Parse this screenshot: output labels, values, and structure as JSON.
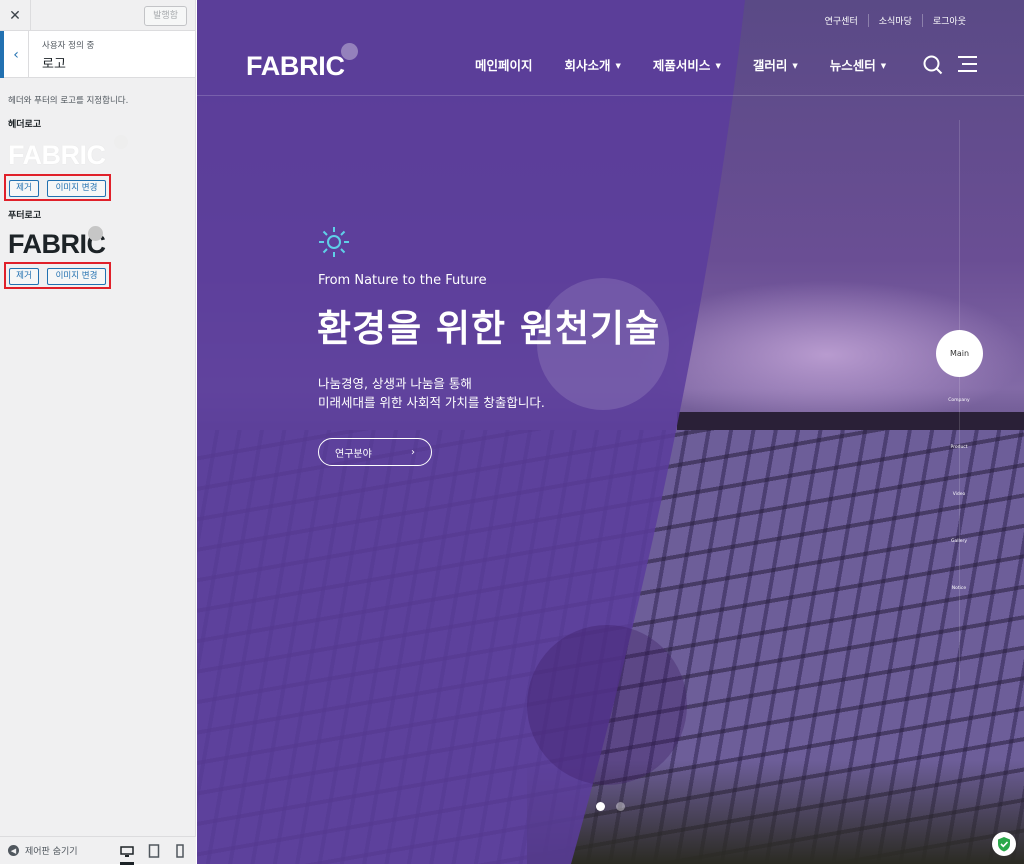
{
  "customizer": {
    "publish_label": "발행함",
    "close_icon": "close-icon",
    "section": {
      "crumb": "사용자 정의 중",
      "title": "로고"
    },
    "description": "헤더와 푸터의 로고를 지정합니다.",
    "header_logo": {
      "label": "헤더로고",
      "preview_text": "FABRIC",
      "remove_label": "제거",
      "change_label": "이미지 변경"
    },
    "footer_logo": {
      "label": "푸터로고",
      "preview_text": "FABRIC",
      "remove_label": "제거",
      "change_label": "이미지 변경"
    },
    "collapse_label": "제어판 숨기기"
  },
  "site": {
    "util_nav": [
      "연구센터",
      "소식마당",
      "로그아웃"
    ],
    "logo_text": "FABRIC",
    "main_nav": [
      {
        "label": "메인페이지",
        "dropdown": false
      },
      {
        "label": "회사소개",
        "dropdown": true
      },
      {
        "label": "제품서비스",
        "dropdown": true
      },
      {
        "label": "갤러리",
        "dropdown": true
      },
      {
        "label": "뉴스센터",
        "dropdown": true
      }
    ],
    "hero": {
      "tagline": "From Nature to the Future",
      "headline": "환경을 위한 원천기술",
      "sub_line1": "나눔경영, 상생과 나눔을 통해",
      "sub_line2": "미래세대를 위한 사회적 가치를 창출합니다.",
      "cta_label": "연구분야"
    },
    "side_nav": {
      "main_label": "Main",
      "items": [
        "Company",
        "Product",
        "Video",
        "Gallery",
        "Notice"
      ]
    }
  },
  "colors": {
    "accent": "#2271b1",
    "highlight_box": "#e0202a",
    "overlay": "#5b3d9c",
    "sun_icon": "#5fd0e8"
  }
}
